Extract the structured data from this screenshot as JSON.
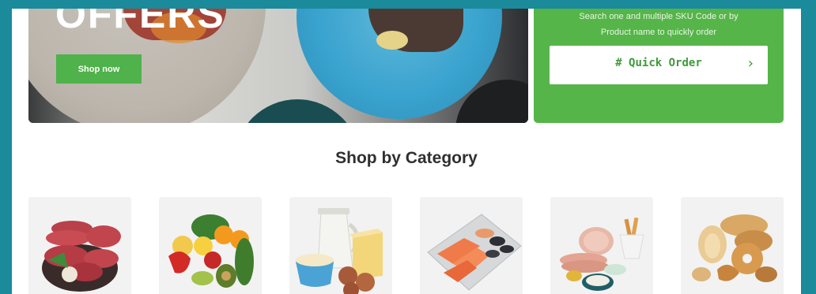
{
  "hero": {
    "title": "OFFERS",
    "shop_now_label": "Shop now"
  },
  "quick_order": {
    "description_line1": "Search one and multiple SKU Code or by",
    "description_line2": "Product name to quickly order",
    "button_label": "# Quick Order",
    "chevron_icon": "chevron-right-icon"
  },
  "categories_section": {
    "title": "Shop by Category",
    "items": [
      {
        "icon": "meat-image"
      },
      {
        "icon": "fruits-vegetables-image"
      },
      {
        "icon": "dairy-image"
      },
      {
        "icon": "seafood-image"
      },
      {
        "icon": "deli-image"
      },
      {
        "icon": "bakery-image"
      }
    ]
  },
  "colors": {
    "brand_green": "#55b548",
    "border_teal": "#1b8a9b"
  }
}
